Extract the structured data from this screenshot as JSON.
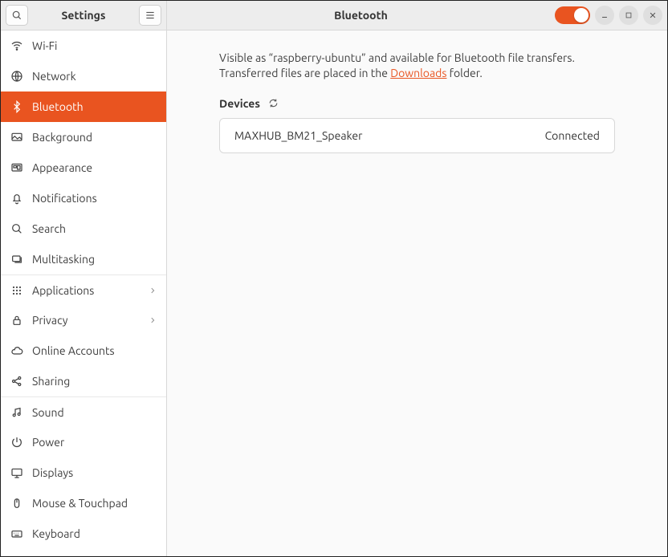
{
  "header": {
    "sidebar_title": "Settings",
    "main_title": "Bluetooth"
  },
  "sidebar": {
    "items": [
      {
        "icon": "wifi",
        "label": "Wi-Fi"
      },
      {
        "icon": "globe",
        "label": "Network"
      },
      {
        "icon": "bluetooth",
        "label": "Bluetooth"
      },
      {
        "icon": "background",
        "label": "Background"
      },
      {
        "icon": "appearance",
        "label": "Appearance"
      },
      {
        "icon": "bell",
        "label": "Notifications"
      },
      {
        "icon": "search",
        "label": "Search"
      },
      {
        "icon": "multitask",
        "label": "Multitasking"
      },
      {
        "icon": "apps",
        "label": "Applications"
      },
      {
        "icon": "lock",
        "label": "Privacy"
      },
      {
        "icon": "cloud",
        "label": "Online Accounts"
      },
      {
        "icon": "share",
        "label": "Sharing"
      },
      {
        "icon": "sound",
        "label": "Sound"
      },
      {
        "icon": "power",
        "label": "Power"
      },
      {
        "icon": "displays",
        "label": "Displays"
      },
      {
        "icon": "mouse",
        "label": "Mouse & Touchpad"
      },
      {
        "icon": "keyboard",
        "label": "Keyboard"
      }
    ]
  },
  "main": {
    "desc_pre": "Visible as “raspberry-ubuntu” and available for Bluetooth file transfers. Transferred files are placed in the ",
    "desc_link": "Downloads",
    "desc_post": " folder.",
    "devices_label": "Devices",
    "devices": [
      {
        "name": "MAXHUB_BM21_Speaker",
        "status": "Connected"
      }
    ]
  }
}
